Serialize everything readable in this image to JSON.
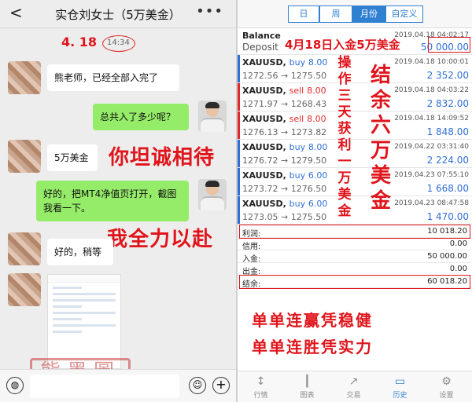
{
  "chat": {
    "back": "<",
    "title": "实仓刘女士（5万美金）",
    "more": "•••",
    "date_annotation": "4. 18",
    "time": "14:34",
    "messages": [
      {
        "side": "in",
        "text": "熊老师，已经全部入完了"
      },
      {
        "side": "out",
        "text": "总共入了多少呢？"
      },
      {
        "side": "in",
        "text": "5万美金"
      },
      {
        "side": "out",
        "text": "好的，把MT4净值页打开，截图我看一下。"
      },
      {
        "side": "in",
        "text": "好的，稍等"
      }
    ],
    "annotation_1": "你坦诚相待",
    "annotation_2": "我全力以赴",
    "seal": "熊墨圖"
  },
  "mt4": {
    "tabs": [
      "日",
      "周",
      "月份",
      "自定义"
    ],
    "active_tab": "月份",
    "balance": {
      "label": "Balance",
      "sub": "Deposit",
      "time": "2019.04.18 04:02:17",
      "amount": "50 000.00"
    },
    "deposit_note": "4月18日入金5万美金",
    "trades": [
      {
        "symbol": "XAUUSD,",
        "side": "buy",
        "vol": "8.00",
        "prices": "1272.56 → 1275.50",
        "time": "2019.04.18 10:00:01",
        "pl": "2 352.00"
      },
      {
        "symbol": "XAUUSD,",
        "side": "sell",
        "vol": "8.00",
        "prices": "1271.97 → 1268.43",
        "time": "2019.04.18 04:03:22",
        "pl": "2 832.00"
      },
      {
        "symbol": "XAUUSD,",
        "side": "sell",
        "vol": "8.00",
        "prices": "1276.13 → 1273.82",
        "time": "2019.04.18 14:09:52",
        "pl": "1 848.00"
      },
      {
        "symbol": "XAUUSD,",
        "side": "buy",
        "vol": "8.00",
        "prices": "1276.72 → 1279.50",
        "time": "2019.04.22 03:31:40",
        "pl": "2 224.00"
      },
      {
        "symbol": "XAUUSD,",
        "side": "buy",
        "vol": "6.00",
        "prices": "1273.72 → 1276.50",
        "time": "2019.04.23 07:55:10",
        "pl": "1 668.00"
      },
      {
        "symbol": "XAUUSD,",
        "side": "buy",
        "vol": "6.00",
        "prices": "1273.05 → 1275.50",
        "time": "2019.04.23 08:47:58",
        "pl": "1 470.00"
      }
    ],
    "note_three_days": [
      "操",
      "作",
      "三",
      "天",
      "获",
      "利",
      "一",
      "万",
      "美",
      "金"
    ],
    "note_result": [
      "结",
      "余",
      "六",
      "万",
      "美",
      "金"
    ],
    "summary": [
      {
        "k": "利润:",
        "v": "10 018.20"
      },
      {
        "k": "信用:",
        "v": "0.00"
      },
      {
        "k": "入金:",
        "v": "50 000.00"
      },
      {
        "k": "出金:",
        "v": "0.00"
      },
      {
        "k": "结余:",
        "v": "60 018.20"
      }
    ],
    "slogan_1": "单单连赢凭稳健",
    "slogan_2": "单单连胜凭实力",
    "bottom_tabs": [
      {
        "label": "行情",
        "icon": "↕"
      },
      {
        "label": "图表",
        "icon": "┃"
      },
      {
        "label": "交易",
        "icon": "↗"
      },
      {
        "label": "历史",
        "icon": "▭"
      },
      {
        "label": "设置",
        "icon": "⚙"
      }
    ],
    "colors": {
      "accent": "#2f80d1",
      "annotation": "#e0141b",
      "buy": "#2f6fd6",
      "sell": "#e02a2a"
    }
  }
}
